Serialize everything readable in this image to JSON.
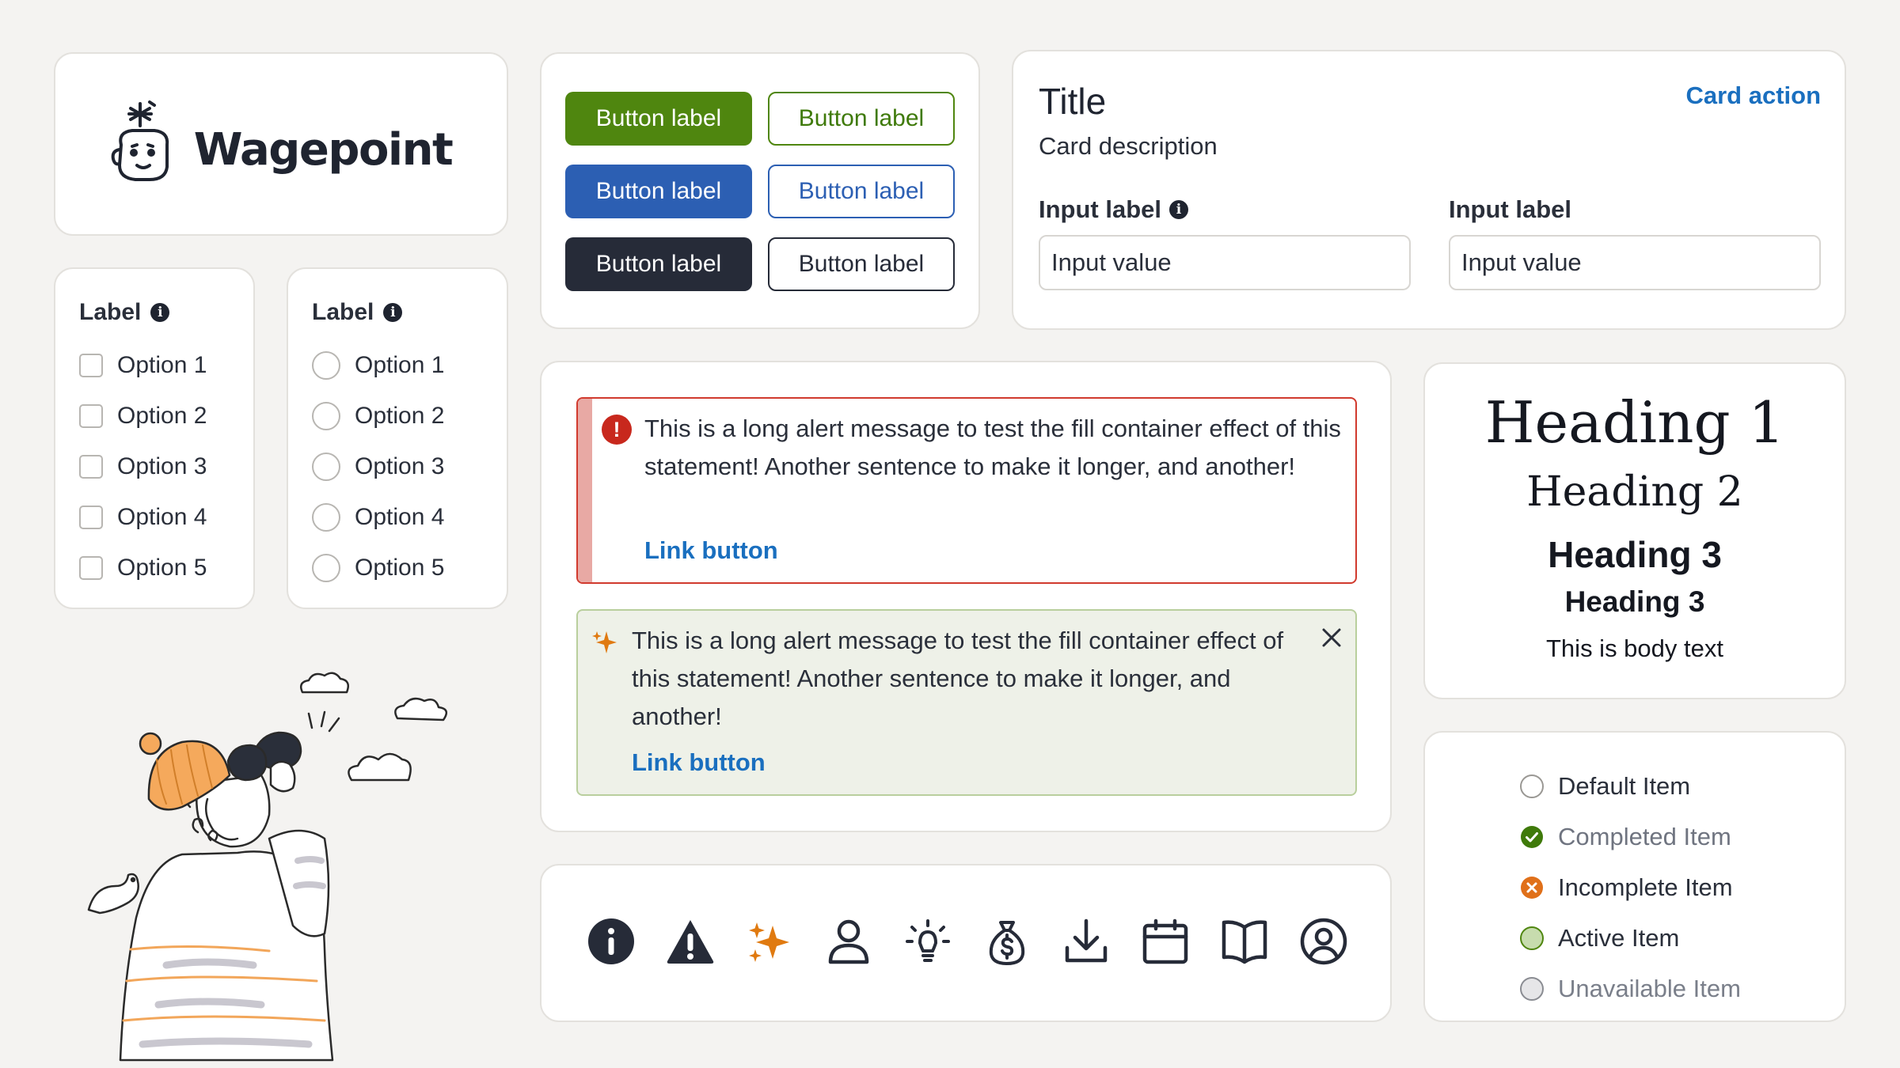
{
  "brand": {
    "name": "Wagepoint"
  },
  "checkbox_group": {
    "label": "Label",
    "options": [
      "Option 1",
      "Option 2",
      "Option 3",
      "Option 4",
      "Option 5"
    ]
  },
  "radio_group": {
    "label": "Label",
    "options": [
      "Option 1",
      "Option 2",
      "Option 3",
      "Option 4",
      "Option 5"
    ]
  },
  "buttons": {
    "green_solid": "Button label",
    "green_outline": "Button label",
    "blue_solid": "Button label",
    "blue_outline": "Button label",
    "dark_solid": "Button label",
    "dark_outline": "Button label"
  },
  "form_card": {
    "title": "Title",
    "description": "Card description",
    "action": "Card action",
    "field1": {
      "label": "Input label",
      "value": "Input value"
    },
    "field2": {
      "label": "Input label",
      "value": "Input value"
    }
  },
  "alerts": {
    "error": {
      "message": "This is a long alert message to test the fill container effect of this statement! Another sentence to make it longer, and another!",
      "link": "Link button"
    },
    "success": {
      "message": "This is a long alert message to test the fill container effect of this statement! Another sentence to make it longer, and another!",
      "link": "Link button"
    }
  },
  "typography": {
    "heading1": "Heading 1",
    "heading2": "Heading 2",
    "heading3a": "Heading 3",
    "heading3b": "Heading 3",
    "body": "This is body text"
  },
  "status_list": [
    {
      "label": "Default Item",
      "state": "default"
    },
    {
      "label": "Completed Item",
      "state": "completed"
    },
    {
      "label": "Incomplete Item",
      "state": "incomplete"
    },
    {
      "label": "Active Item",
      "state": "active"
    },
    {
      "label": "Unavailable Item",
      "state": "unavailable"
    }
  ],
  "icons": [
    "info-icon",
    "warning-icon",
    "sparkle-icon",
    "user-icon",
    "lightbulb-icon",
    "money-bag-icon",
    "download-icon",
    "calendar-icon",
    "book-icon",
    "user-circle-icon"
  ],
  "colors": {
    "green": "#4f860f",
    "blue": "#2c5fb3",
    "dark": "#262b38",
    "error": "#c8281d",
    "link": "#1a6fbf",
    "accent_orange": "#e07a10",
    "background": "#f4f3f1"
  }
}
